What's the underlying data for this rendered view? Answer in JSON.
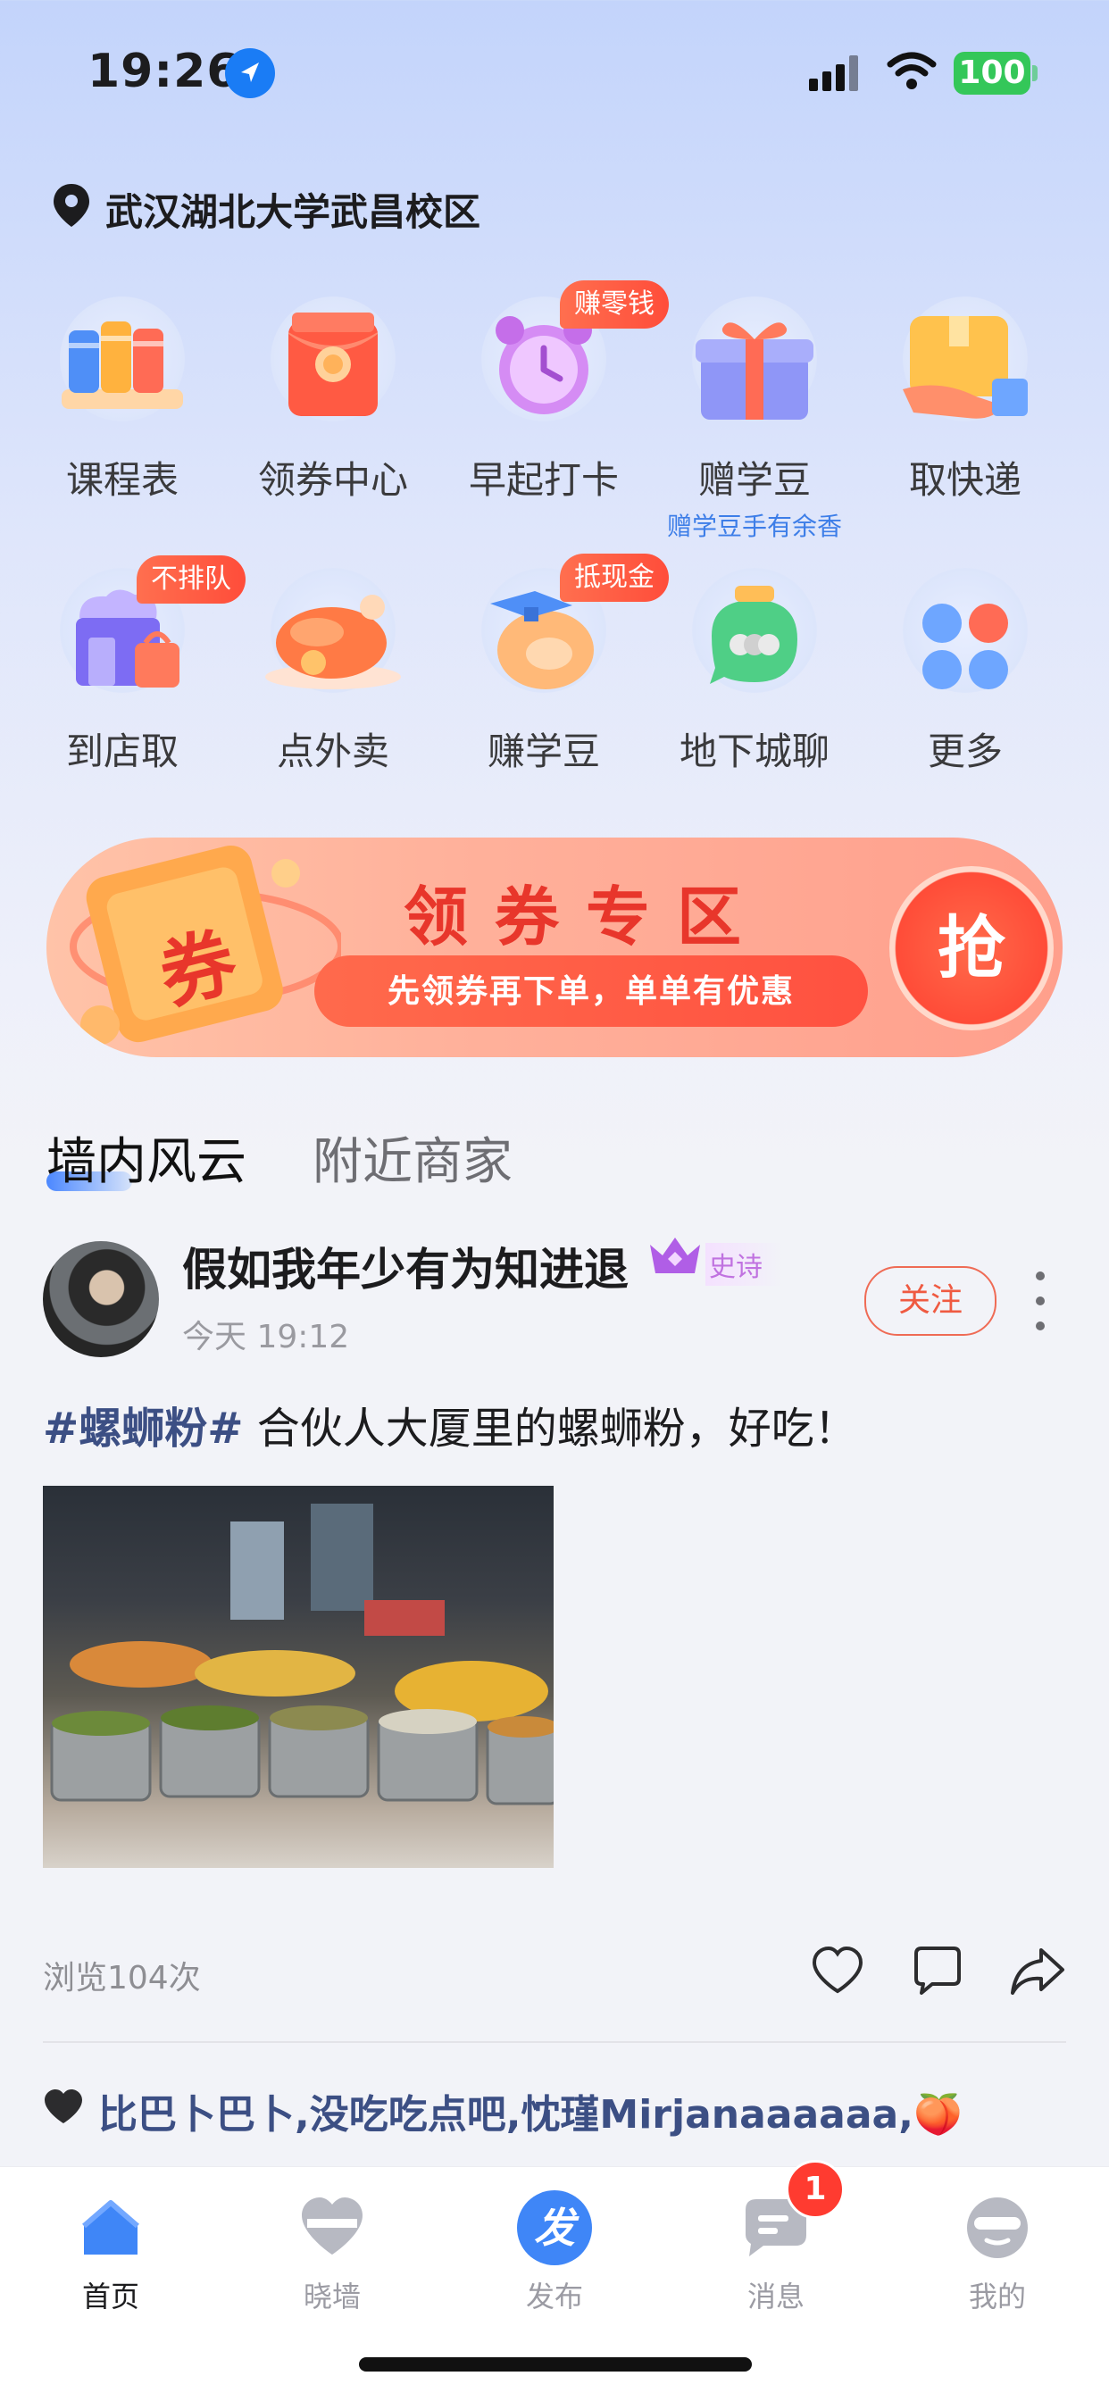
{
  "status_bar": {
    "time": "19:26",
    "battery": "100"
  },
  "location": {
    "text": "武汉湖北大学武昌校区"
  },
  "grid": {
    "items": [
      {
        "label": "课程表"
      },
      {
        "label": "领券中心"
      },
      {
        "label": "早起打卡",
        "badge": "赚零钱"
      },
      {
        "label": "赠学豆",
        "sub": "赠学豆手有余香"
      },
      {
        "label": "取快递"
      },
      {
        "label": "到店取",
        "badge": "不排队"
      },
      {
        "label": "点外卖"
      },
      {
        "label": "赚学豆",
        "badge": "抵现金"
      },
      {
        "label": "地下城聊"
      },
      {
        "label": "更多"
      }
    ]
  },
  "banner": {
    "title": "领券专区",
    "subtitle": "先领券再下单，单单有优惠",
    "button": "抢",
    "coupon_text": "券"
  },
  "tabs": {
    "active": "墙内风云",
    "inactive": "附近商家"
  },
  "post": {
    "user_name": "假如我年少有为知进退",
    "rank": "史诗",
    "time": "今天 19:12",
    "follow": "关注",
    "hashtag": "#螺蛳粉#",
    "text": " 合伙人大厦里的螺蛳粉，好吃！",
    "views": "浏览104次",
    "likes": "比巴卜巴卜,没吃吃点吧,忱瑾Mirjanaaaaaa,🍑"
  },
  "tabbar": {
    "items": [
      {
        "label": "首页"
      },
      {
        "label": "晓墙"
      },
      {
        "label": "发布",
        "icon_text": "发"
      },
      {
        "label": "消息"
      },
      {
        "label": "我的"
      }
    ],
    "message_badge": "1"
  },
  "colors": {
    "accent": "#3d7ee8",
    "badge": "#ff4d3a",
    "follow": "#ef5a41",
    "brand_blue": "#1a7cf5"
  }
}
